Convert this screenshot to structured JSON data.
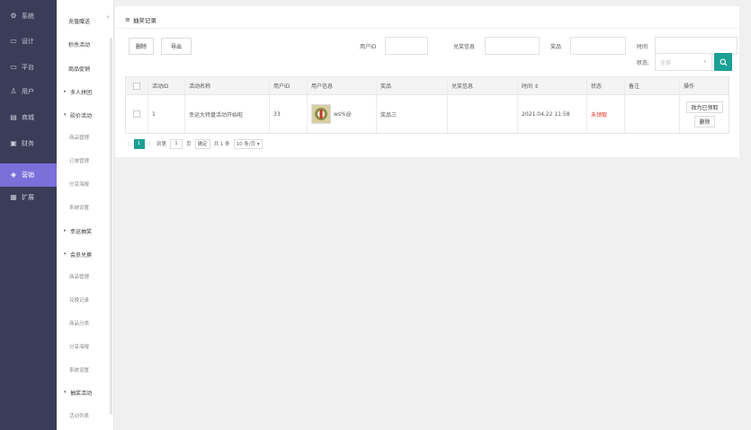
{
  "nav": {
    "items": [
      {
        "icon": "gear-icon",
        "glyph": "⚙",
        "label": "系统"
      },
      {
        "icon": "monitor-icon",
        "glyph": "▭",
        "label": "设计"
      },
      {
        "icon": "monitor-icon",
        "glyph": "▭",
        "label": "平台"
      },
      {
        "icon": "user-icon",
        "glyph": "♙",
        "label": "用户"
      },
      {
        "icon": "shop-icon",
        "glyph": "▤",
        "label": "商城"
      },
      {
        "icon": "finance-icon",
        "glyph": "▣",
        "label": "财务"
      },
      {
        "icon": "marketing-icon",
        "glyph": "◈",
        "label": "营销"
      },
      {
        "icon": "extend-icon",
        "glyph": "▦",
        "label": "扩展"
      }
    ],
    "active_index": 6
  },
  "submenu": {
    "items": [
      {
        "label": "充值赠送",
        "kind": "item"
      },
      {
        "label": "秒杀活动",
        "kind": "item"
      },
      {
        "label": "商品促销",
        "kind": "item"
      },
      {
        "label": "多人拼团",
        "kind": "grp",
        "arrow": "▸"
      },
      {
        "label": "砍价活动",
        "kind": "grp",
        "arrow": "▾"
      },
      {
        "label": "商品管理",
        "kind": "child"
      },
      {
        "label": "订单管理",
        "kind": "child"
      },
      {
        "label": "分享海报",
        "kind": "child"
      },
      {
        "label": "系统设置",
        "kind": "child"
      },
      {
        "label": "幸运抽奖",
        "kind": "grp",
        "arrow": "▸"
      },
      {
        "label": "会员兑换",
        "kind": "grp",
        "arrow": "▾"
      },
      {
        "label": "商品管理",
        "kind": "child"
      },
      {
        "label": "兑换记录",
        "kind": "child"
      },
      {
        "label": "商品分类",
        "kind": "child"
      },
      {
        "label": "分享海报",
        "kind": "child"
      },
      {
        "label": "系统设置",
        "kind": "child"
      },
      {
        "label": "抽奖活动",
        "kind": "grp",
        "arrow": "▾"
      },
      {
        "label": "活动列表",
        "kind": "child"
      }
    ],
    "collapse_glyph": "«"
  },
  "card": {
    "title_icon": "≡",
    "title": "抽奖记录"
  },
  "toolbar": {
    "delete_label": "删除",
    "export_label": "导出",
    "user_id_label": "用户ID",
    "prize_info_label": "兑奖信息",
    "prize_label": "奖品",
    "time_label": "时间",
    "status_label": "状态:",
    "status_value": "全部",
    "caret": "▾"
  },
  "table": {
    "headers": [
      "活动ID",
      "活动名称",
      "用户ID",
      "用户信息",
      "奖品",
      "兑奖信息",
      "时间 ⇕",
      "状态",
      "备注",
      "操作"
    ],
    "rows": [
      {
        "activity_id": "1",
        "activity_name": "幸运大转盘活动开始啦",
        "user_id": "33",
        "user_info": "ws%@",
        "prize": "奖品三",
        "prize_info": "",
        "time": "2021.04.22 11:58",
        "status": "未领取",
        "remark": "",
        "op_mark": "改为已领取",
        "op_delete": "删除"
      }
    ]
  },
  "pager": {
    "prev": "〈",
    "current": "1",
    "next": "〉",
    "goto_prefix": "到第",
    "goto_value": "1",
    "goto_suffix": "页",
    "confirm": "确定",
    "total": "共 1 条",
    "page_size": "10 条/页 ▾"
  }
}
